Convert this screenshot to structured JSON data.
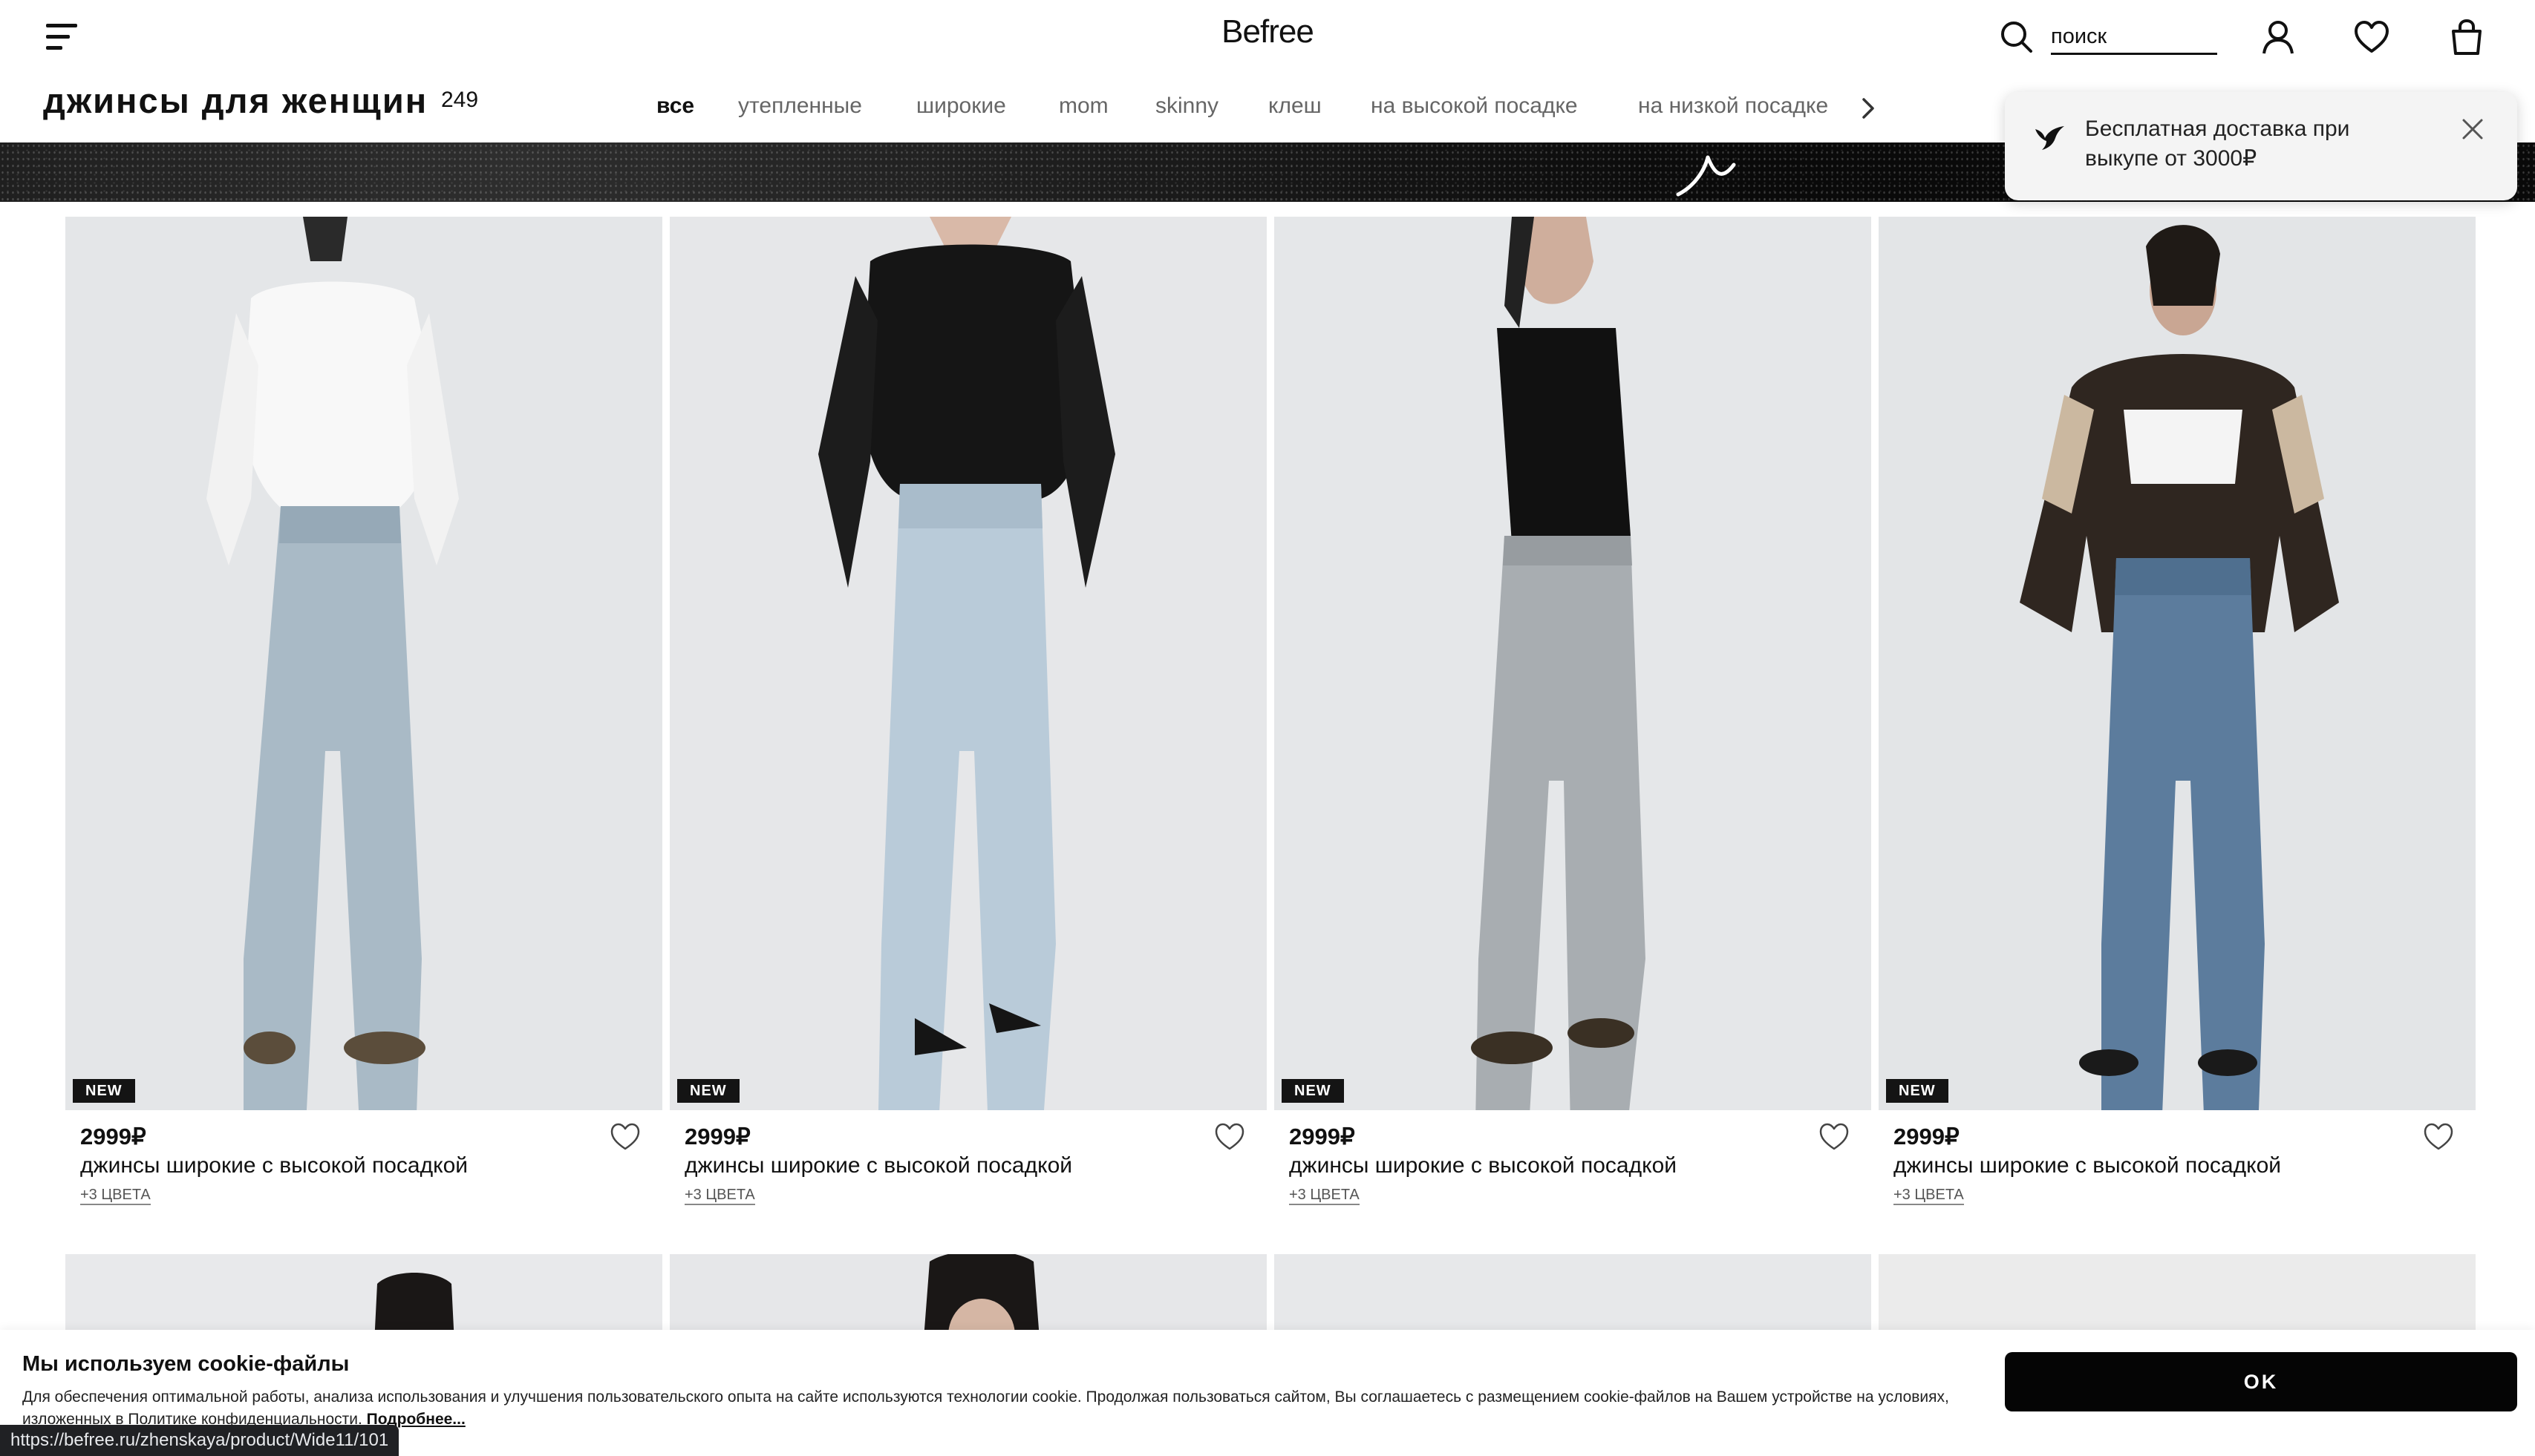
{
  "header": {
    "logo": "Befree",
    "search_placeholder": "поиск",
    "icons": [
      "menu-icon",
      "search-icon",
      "user-icon",
      "heart-icon",
      "bag-icon"
    ]
  },
  "page": {
    "title": "джинсы для женщин",
    "count": "249"
  },
  "filters": [
    "все",
    "утепленные",
    "широкие",
    "mom",
    "skinny",
    "клеш",
    "на высокой посадке",
    "на низкой посадке"
  ],
  "active_filter": "все",
  "toast": {
    "text": "Бесплатная доставка при выкупе от 3000₽"
  },
  "products": [
    {
      "badge": "NEW",
      "price": "2999₽",
      "name": "джинсы широкие с высокой посадкой",
      "colors": "+3 ЦВЕТА"
    },
    {
      "badge": "NEW",
      "price": "2999₽",
      "name": "джинсы широкие с высокой посадкой",
      "colors": "+3 ЦВЕТА"
    },
    {
      "badge": "NEW",
      "price": "2999₽",
      "name": "джинсы широкие с высокой посадкой",
      "colors": "+3 ЦВЕТА"
    },
    {
      "badge": "NEW",
      "price": "2999₽",
      "name": "джинсы широкие с высокой посадкой",
      "colors": "+3 ЦВЕТА"
    }
  ],
  "cookie": {
    "title": "Мы используем cookie-файлы",
    "text": "Для обеспечения оптимальной работы, анализа использования и улучшения пользовательского опыта на сайте используются технологии cookie. Продолжая пользоваться сайтом, Вы соглашаетесь с размещением cookie-файлов на Вашем устройстве на условиях, изложенных в Политике конфиденциальности.",
    "more": "Подробнее...",
    "ok": "OK"
  },
  "status_url": "https://befree.ru/zhenskaya/product/Wide11/101",
  "colors": {
    "text": "#111111",
    "muted": "#666666",
    "photo_bg": "#e3e5e7",
    "badge_bg": "#141414",
    "button_bg": "#050505"
  }
}
